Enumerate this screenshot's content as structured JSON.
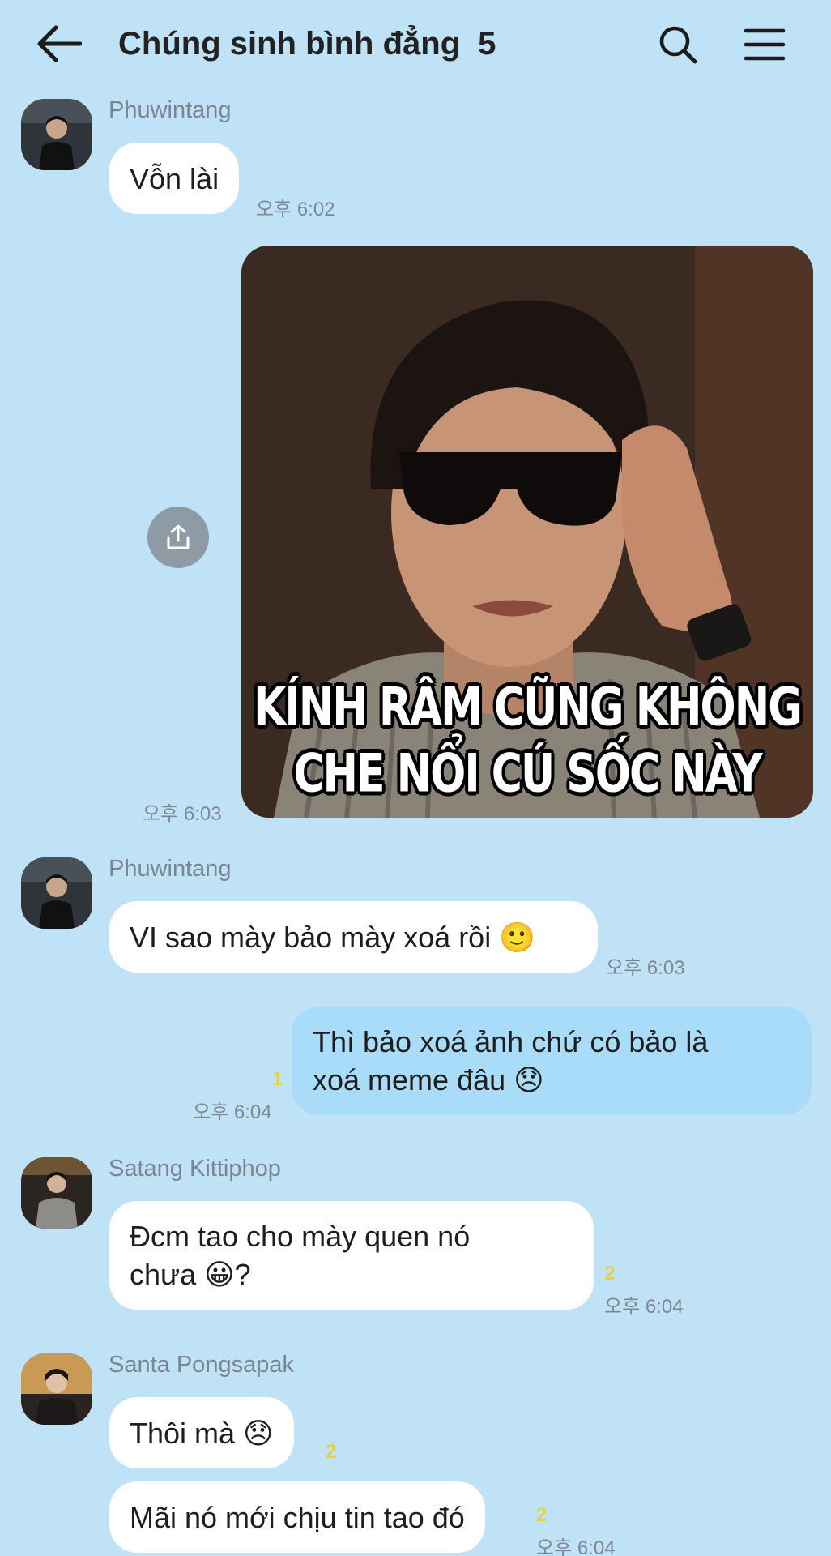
{
  "header": {
    "title": "Chúng sinh bình đẳng",
    "member_count": "5"
  },
  "messages": [
    {
      "sender": "Phuwintang",
      "text": "Vỗn lài",
      "time": "오후 6:02"
    },
    {
      "type": "image",
      "caption_line1": "KÍNH RÂM CŨNG KHÔNG",
      "caption_line2": "CHE NỔI CÚ SỐC NÀY",
      "time": "오후 6:03"
    },
    {
      "sender": "Phuwintang",
      "text": "VI sao mày bảo mày xoá rồi 🙂",
      "time": "오후 6:03"
    },
    {
      "outgoing": true,
      "line1": "Thì bảo xoá ảnh chứ có bảo là",
      "line2": "xoá meme đâu 😞",
      "unread": "1",
      "time": "오후 6:04"
    },
    {
      "sender": "Satang Kittiphop",
      "line1": "Đcm tao cho mày quen nó",
      "line2": "chưa 😀?",
      "unread": "2",
      "time": "오후 6:04"
    },
    {
      "sender": "Santa Pongsapak",
      "text": "Thôi mà 😞",
      "unread": "2"
    },
    {
      "text": "Mãi nó mới chịu tin tao đó",
      "unread": "2",
      "time": "오후 6:04"
    }
  ],
  "colors": {
    "background": "#bfe2f6",
    "incoming_bubble": "#ffffff",
    "outgoing_bubble": "#a9dcf8",
    "unread_count": "#e8d13c"
  },
  "icons": {
    "back": "back-arrow-icon",
    "search": "search-icon",
    "menu": "menu-icon",
    "share": "share-icon"
  }
}
